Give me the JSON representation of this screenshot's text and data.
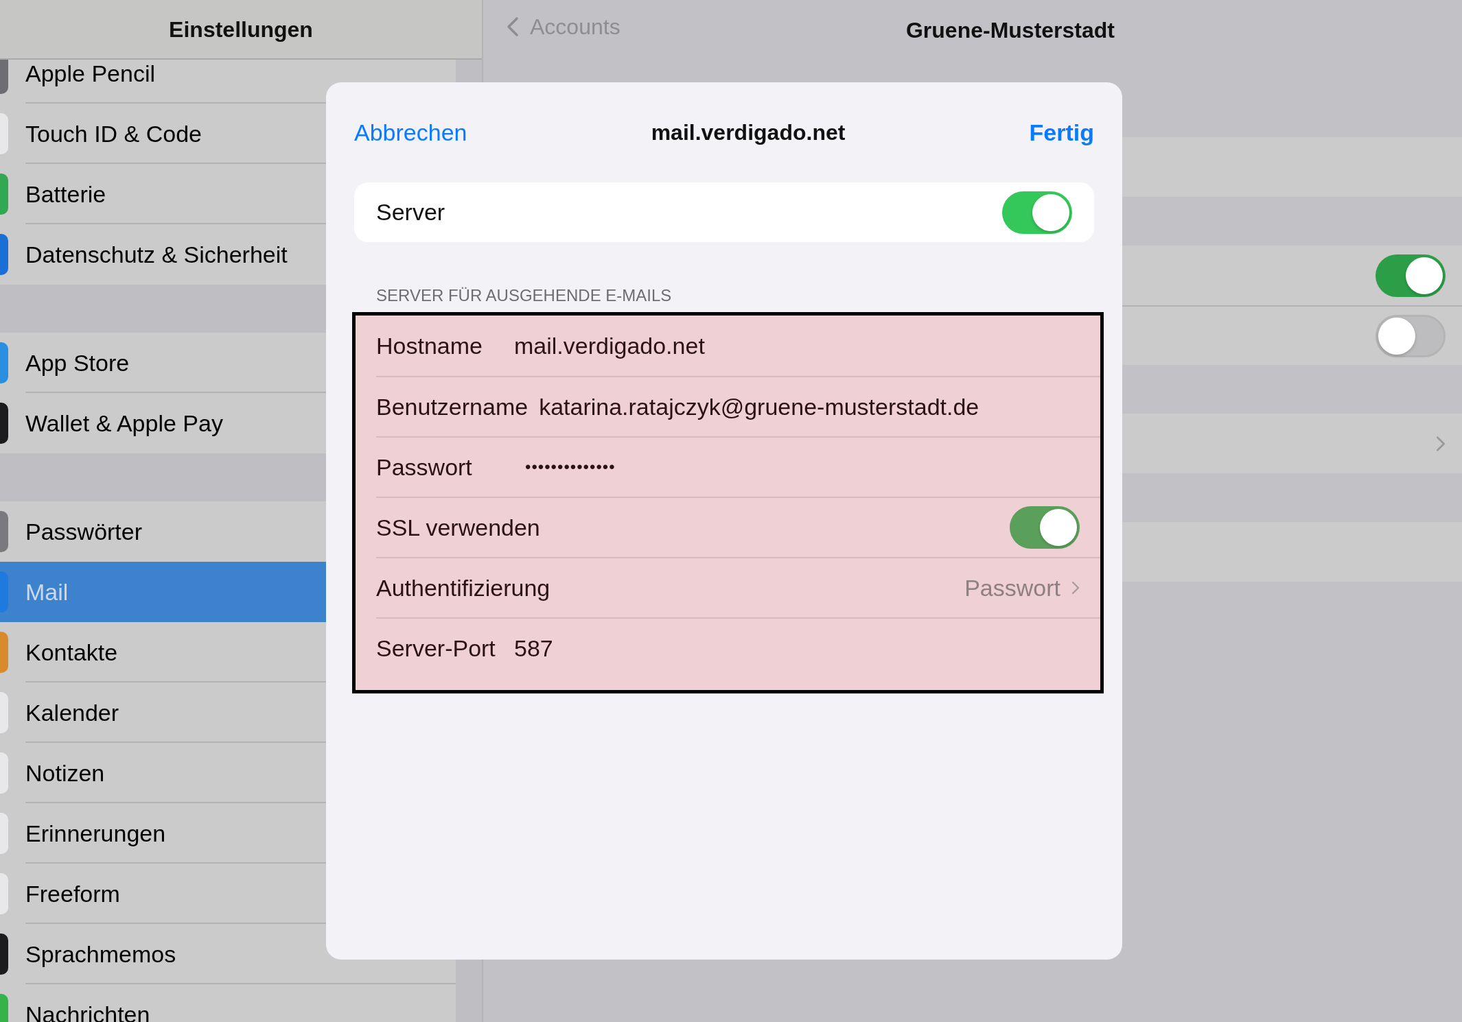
{
  "sidebar": {
    "title": "Einstellungen",
    "groups": [
      {
        "items": [
          {
            "label": "Apple Pencil",
            "color": "#6e6e72",
            "selected": false
          },
          {
            "label": "Touch ID & Code",
            "color": "#e8e8ea",
            "selected": false
          },
          {
            "label": "Batterie",
            "color": "#32a852",
            "selected": false
          },
          {
            "label": "Datenschutz & Sicherheit",
            "color": "#1a6fd6",
            "selected": false
          }
        ]
      },
      {
        "items": [
          {
            "label": "App Store",
            "color": "#2a8fe0",
            "selected": false
          },
          {
            "label": "Wallet & Apple Pay",
            "color": "#1c1c1e",
            "selected": false
          }
        ]
      },
      {
        "items": [
          {
            "label": "Passwörter",
            "color": "#7a7a7e",
            "selected": false
          },
          {
            "label": "Mail",
            "color": "#1f7ae0",
            "selected": true
          },
          {
            "label": "Kontakte",
            "color": "#d98a2b",
            "selected": false
          },
          {
            "label": "Kalender",
            "color": "#e8e8ea",
            "selected": false
          },
          {
            "label": "Notizen",
            "color": "#e8e8ea",
            "selected": false
          },
          {
            "label": "Erinnerungen",
            "color": "#e8e8ea",
            "selected": false
          },
          {
            "label": "Freeform",
            "color": "#e8e8ea",
            "selected": false
          },
          {
            "label": "Sprachmemos",
            "color": "#1c1c1e",
            "selected": false
          },
          {
            "label": "Nachrichten",
            "color": "#34b34a",
            "selected": false
          }
        ]
      }
    ]
  },
  "detail": {
    "back": "Accounts",
    "title": "Gruene-Musterstadt",
    "cards": [
      {
        "rows": [
          {
            "kind": "blank"
          }
        ]
      },
      {
        "rows": [
          {
            "kind": "toggle",
            "on": true
          },
          {
            "kind": "toggle",
            "on": false
          }
        ]
      },
      {
        "rows": [
          {
            "kind": "link"
          }
        ]
      },
      {
        "rows": [
          {
            "kind": "blank"
          }
        ]
      }
    ]
  },
  "modal": {
    "cancel": "Abbrechen",
    "title": "mail.verdigado.net",
    "done": "Fertig",
    "server": {
      "label": "Server",
      "on": true
    },
    "section_header": "SERVER FÜR AUSGEHENDE E-MAILS",
    "rows": [
      {
        "kind": "text",
        "label": "Hostname",
        "value": "mail.verdigado.net"
      },
      {
        "kind": "text",
        "label": "Benutzername",
        "value": "katarina.ratajczyk@gruene-musterstadt.de"
      },
      {
        "kind": "password",
        "label": "Passwort",
        "value": "••••••••••••••"
      },
      {
        "kind": "toggle",
        "label": "SSL verwenden",
        "on": true
      },
      {
        "kind": "link",
        "label": "Authentifizierung",
        "value": "Passwort"
      },
      {
        "kind": "text",
        "label": "Server-Port",
        "value": "587"
      }
    ]
  }
}
